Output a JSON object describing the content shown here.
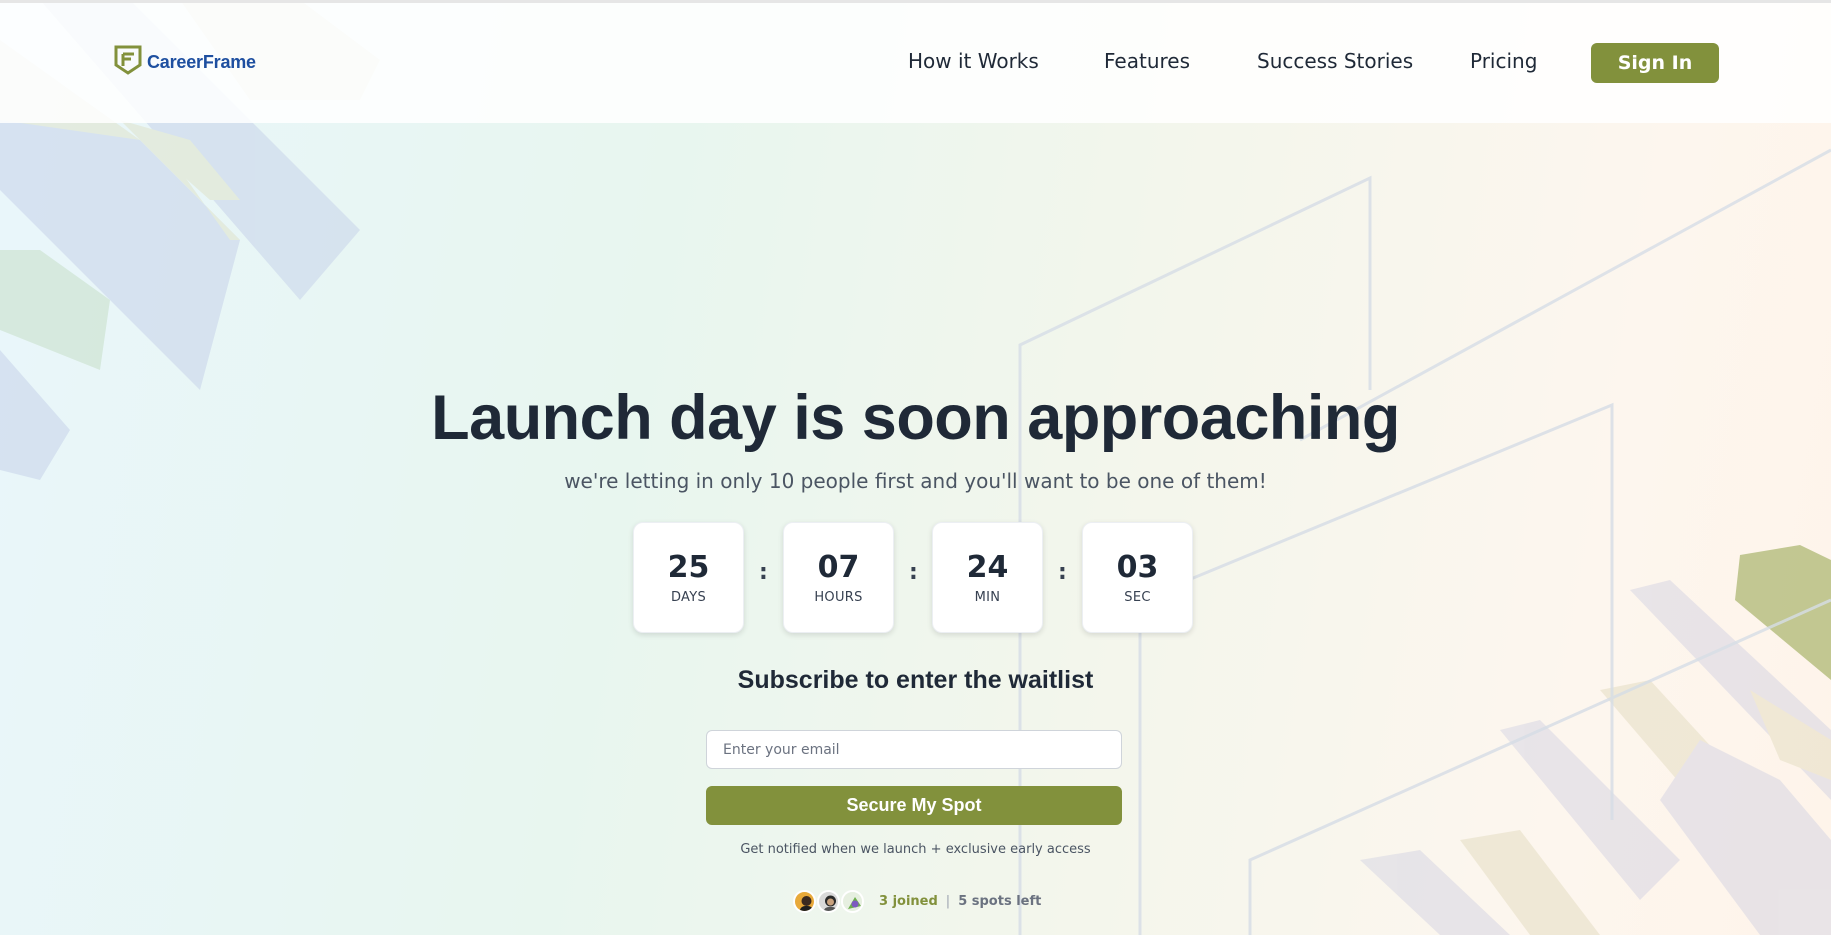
{
  "header": {
    "logo": {
      "text": "CareerFrame",
      "icon": "shield-frame-icon"
    },
    "nav": [
      {
        "label": "How it Works"
      },
      {
        "label": "Features"
      },
      {
        "label": "Success Stories"
      },
      {
        "label": "Pricing"
      }
    ],
    "signin_label": "Sign In"
  },
  "hero": {
    "headline": "Launch day is soon approaching",
    "subline": "we're letting in only 10 people first and you'll want to be one of them!"
  },
  "countdown": {
    "days": {
      "value": "25",
      "label": "DAYS"
    },
    "hours": {
      "value": "07",
      "label": "HOURS"
    },
    "minutes": {
      "value": "24",
      "label": "MIN"
    },
    "seconds": {
      "value": "03",
      "label": "SEC"
    },
    "separator": ":"
  },
  "waitlist": {
    "title": "Subscribe to enter the waitlist",
    "email_placeholder": "Enter your email",
    "email_value": "",
    "button_label": "Secure My Spot",
    "note": "Get notified when we launch + exclusive early access",
    "joined": "3 joined",
    "divider": "|",
    "spots_left": "5 spots left",
    "avatars": [
      "user-avatar-1",
      "user-avatar-2",
      "user-avatar-3"
    ]
  },
  "colors": {
    "brand_green": "#82913c",
    "logo_blue": "#1e4fa0",
    "text_dark": "#1f2937"
  }
}
